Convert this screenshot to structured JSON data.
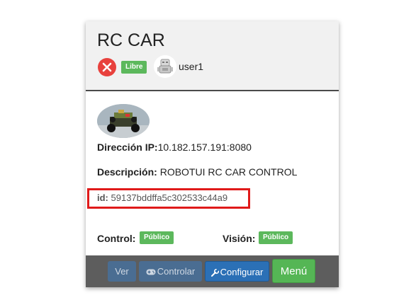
{
  "robot": {
    "title": "RC CAR",
    "status_badge": "Libre",
    "owner": "user1"
  },
  "details": {
    "ip_label": "Dirección IP:",
    "ip_value": "10.182.157.191:8080",
    "desc_label": "Descripción:",
    "desc_value": " ROBOTUI RC CAR CONTROL",
    "id_label": "id:",
    "id_value": " 59137bddffa5c302533c44a9"
  },
  "permissions": {
    "control_label": "Control:",
    "control_value": "Público",
    "vision_label": "Visión:",
    "vision_value": "Público"
  },
  "footer": {
    "ver_label": "Ver",
    "controlar_label": "Controlar",
    "configurar_label": "Configurar",
    "menu_label": "Menú"
  },
  "icons": {
    "close": "close-icon",
    "avatar": "robot-avatar-icon",
    "gamepad": "gamepad-icon",
    "wrench": "wrench-icon"
  },
  "colors": {
    "libre_badge": "#5cb85c",
    "close_button": "#e8413d",
    "highlight_border": "#e01a1a",
    "configurar_button": "#2b70b6",
    "menu_button": "#55b655",
    "footer_bg": "#5d5d5d"
  }
}
